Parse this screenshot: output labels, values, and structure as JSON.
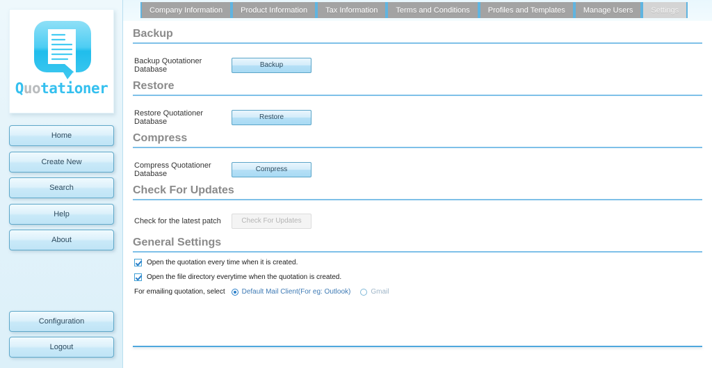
{
  "app": {
    "name": "Quotationer",
    "logo_word_prefix": "Q",
    "logo_word_middle": "uo",
    "logo_word_suffix": "tationer",
    "accent_color": "#35c0ef",
    "heading_color": "#8a8a8a",
    "rule_color": "#7ec0e8"
  },
  "sidebar": {
    "items": [
      {
        "label": "Home"
      },
      {
        "label": "Create New"
      },
      {
        "label": "Search"
      },
      {
        "label": "Help"
      },
      {
        "label": "About"
      }
    ],
    "bottom_items": [
      {
        "label": "Configuration"
      },
      {
        "label": "Logout"
      }
    ]
  },
  "tabs": [
    {
      "label": "Company Information",
      "active": false
    },
    {
      "label": "Product Information",
      "active": false
    },
    {
      "label": "Tax Information",
      "active": false
    },
    {
      "label": "Terms and Conditions",
      "active": false
    },
    {
      "label": "Profiles and Templates",
      "active": false
    },
    {
      "label": "Manage Users",
      "active": false
    },
    {
      "label": "Settings",
      "active": true
    }
  ],
  "sections": {
    "backup": {
      "heading": "Backup",
      "row_label": "Backup Quotationer Database",
      "button_label": "Backup"
    },
    "restore": {
      "heading": "Restore",
      "row_label": "Restore Quotationer Database",
      "button_label": "Restore"
    },
    "compress": {
      "heading": "Compress",
      "row_label": "Compress Quotationer Database",
      "button_label": "Compress"
    },
    "updates": {
      "heading": "Check For Updates",
      "row_label": "Check for the latest patch",
      "button_label": "Check For Updates",
      "button_disabled": true
    },
    "general": {
      "heading": "General Settings",
      "checkbox_open_quotation": {
        "label": "Open the quotation every time when it is created.",
        "checked": true
      },
      "checkbox_open_directory": {
        "label": "Open the file directory everytime when the quotation is created.",
        "checked": true
      },
      "email_lead_label": "For emailing quotation, select",
      "email_options": [
        {
          "label": "Default Mail Client(For eg: Outlook)",
          "selected": true
        },
        {
          "label": "Gmail",
          "selected": false
        }
      ]
    }
  }
}
